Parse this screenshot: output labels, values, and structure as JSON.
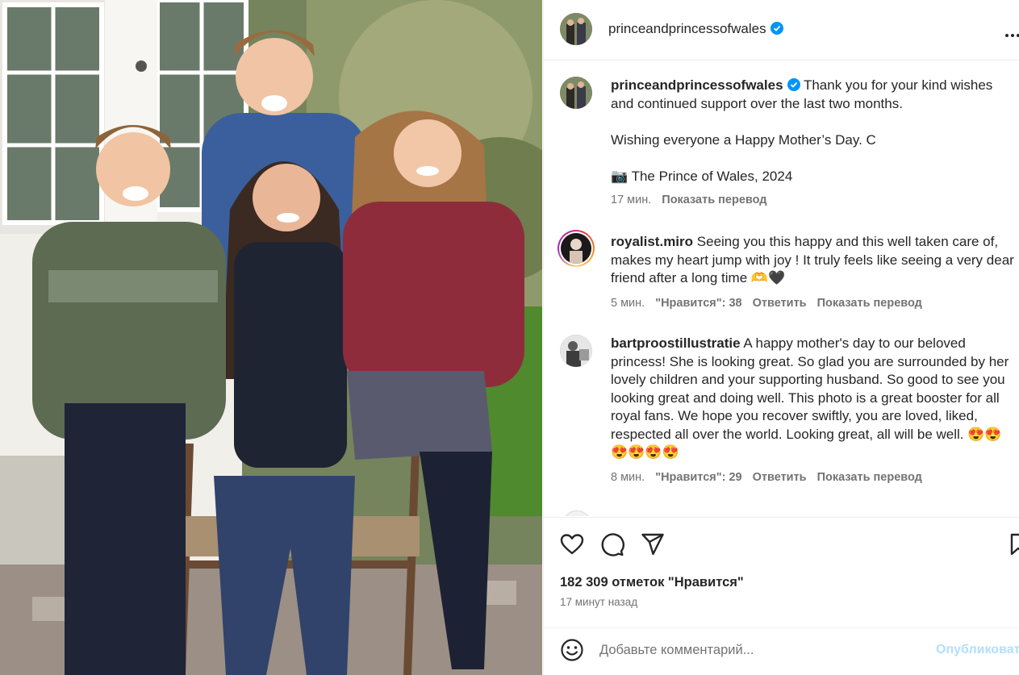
{
  "post": {
    "username": "princeandprincessofwales",
    "verified": true,
    "image_description_icon": "family-photo",
    "more_icon": "more-options-icon"
  },
  "caption": {
    "username": "princeandprincessofwales",
    "line1": "Thank you for your kind wishes and continued support over the last two months.",
    "line2": "Wishing everyone a Happy Mother’s Day. C",
    "line3": "📷 The Prince of Wales, 2024",
    "time": "17 мин.",
    "translate": "Показать перевод"
  },
  "comments": [
    {
      "username": "royalist.miro",
      "text": "Seeing you this happy and this well taken care of, makes my heart jump with joy ! It truly feels like seeing a very dear friend after a long time 🫶🖤",
      "time": "5 мин.",
      "likes": "\"Нравится\": 38",
      "reply": "Ответить",
      "translate": "Показать перевод",
      "has_story": true
    },
    {
      "username": "bartproostillustratie",
      "text": "A happy mother's day to our beloved princess! She is looking great. So glad you are surrounded by her lovely children and your supporting husband. So good to see you looking great and doing well. This photo is a great booster for all royal fans. We hope you recover swiftly, you are loved, liked, respected all over the world. Looking great, all will be well. 😍😍😍😍😍😍",
      "time": "8 мин.",
      "likes": "\"Нравится\": 29",
      "reply": "Ответить",
      "translate": "Показать перевод",
      "has_story": false
    }
  ],
  "actions": {
    "like_icon": "heart-icon",
    "comment_icon": "comment-icon",
    "share_icon": "share-icon",
    "save_icon": "bookmark-icon",
    "likes_count": "182 309 отметок \"Нравится\"",
    "time_ago": "17 минут назад"
  },
  "add_comment": {
    "emoji_icon": "emoji-icon",
    "placeholder": "Добавьте комментарий...",
    "publish_label": "Опубликовать"
  },
  "colors": {
    "verified": "#0095f6",
    "publish_disabled": "#b2dffc",
    "secondary_text": "#737373"
  }
}
